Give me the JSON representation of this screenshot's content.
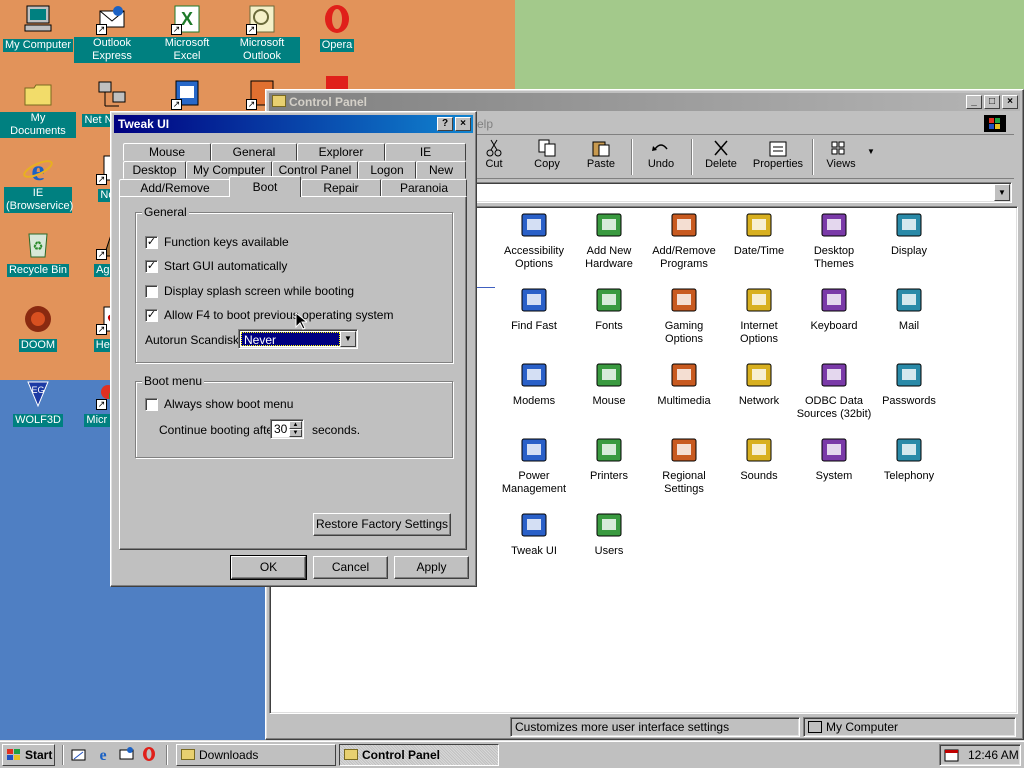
{
  "desktop": {
    "icons": [
      {
        "label": "My Computer"
      },
      {
        "label": "Outlook Express"
      },
      {
        "label": "Microsoft Excel"
      },
      {
        "label": "Microsoft Outlook"
      },
      {
        "label": "Opera"
      },
      {
        "label": "My Documents"
      },
      {
        "label": "Net Neighb"
      },
      {
        "label": "IE (Browservice)"
      },
      {
        "label": "Note"
      },
      {
        "label": "Recycle Bin"
      },
      {
        "label": "Age of"
      },
      {
        "label": "DOOM"
      },
      {
        "label": "Hearts"
      },
      {
        "label": "WOLF3D"
      },
      {
        "label": "Micr Visua"
      }
    ]
  },
  "control_panel": {
    "title": "Control Panel",
    "menu_partial": "elp",
    "toolbar": [
      "Cut",
      "Copy",
      "Paste",
      "Undo",
      "Delete",
      "Properties",
      "Views"
    ],
    "items": [
      "Accessibility Options",
      "Add New Hardware",
      "Add/Remove Programs",
      "Date/Time",
      "Desktop Themes",
      "Display",
      "Find Fast",
      "Fonts",
      "Gaming Options",
      "Internet Options",
      "Keyboard",
      "Mail",
      "Modems",
      "Mouse",
      "Multimedia",
      "Network",
      "ODBC Data Sources (32bit)",
      "Passwords",
      "Power Management",
      "Printers",
      "Regional Settings",
      "Sounds",
      "System",
      "Telephony",
      "Tweak UI",
      "Users"
    ],
    "status_left": "Customizes more user interface settings",
    "status_right": "My Computer"
  },
  "tweak_ui": {
    "title": "Tweak UI",
    "help_btn": "?",
    "close_btn": "×",
    "tabs_row1": [
      "Mouse",
      "General",
      "Explorer",
      "IE"
    ],
    "tabs_row2": [
      "Desktop",
      "My Computer",
      "Control Panel",
      "Logon",
      "New"
    ],
    "tabs_row3": [
      "Add/Remove",
      "Boot",
      "Repair",
      "Paranoia"
    ],
    "general_group": "General",
    "options": [
      {
        "label": "Function keys available",
        "checked": true
      },
      {
        "label": "Start GUI automatically",
        "checked": true
      },
      {
        "label": "Display splash screen while booting",
        "checked": false
      },
      {
        "label": "Allow F4 to boot previous operating system",
        "checked": true
      }
    ],
    "autorun_label": "Autorun Scandisk:",
    "autorun_value": "Never",
    "boot_group": "Boot menu",
    "always_show": {
      "label": "Always show boot menu",
      "checked": false
    },
    "continue_label": "Continue booting after",
    "continue_value": "30",
    "seconds_label": "seconds.",
    "restore_btn": "Restore Factory Settings",
    "ok_btn": "OK",
    "cancel_btn": "Cancel",
    "apply_btn": "Apply"
  },
  "taskbar": {
    "start": "Start",
    "tasks": [
      "Downloads",
      "Control Panel"
    ],
    "clock": "12:46 AM"
  },
  "colors": {
    "active_title": "#000080",
    "desktop_teal": "#008080",
    "face": "#c0c0c0"
  }
}
